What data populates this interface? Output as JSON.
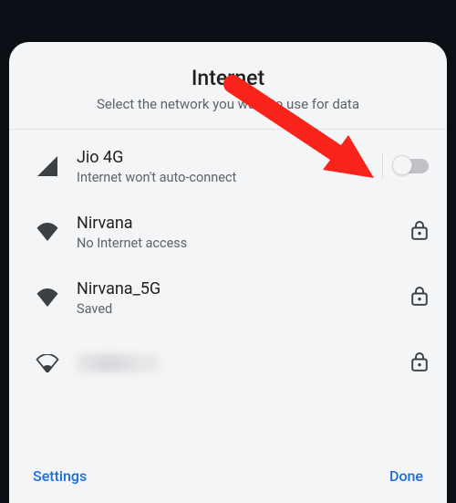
{
  "header": {
    "title": "Internet",
    "subtitle": "Select the network you want to use for data"
  },
  "networks": [
    {
      "icon": "signal-cellular-icon",
      "primary": "Jio 4G",
      "secondary": "Internet won't auto-connect",
      "trailing": "toggle",
      "toggle_on": false
    },
    {
      "icon": "wifi-full-icon",
      "primary": "Nirvana",
      "secondary": "No Internet access",
      "trailing": "lock"
    },
    {
      "icon": "wifi-full-icon",
      "primary": "Nirvana_5G",
      "secondary": "Saved",
      "trailing": "lock"
    },
    {
      "icon": "wifi-weak-icon",
      "primary_blurred": true,
      "trailing": "lock"
    }
  ],
  "footer": {
    "settings": "Settings",
    "done": "Done"
  },
  "colors": {
    "accent": "#1a6de0",
    "annotation": "#f8241b"
  }
}
